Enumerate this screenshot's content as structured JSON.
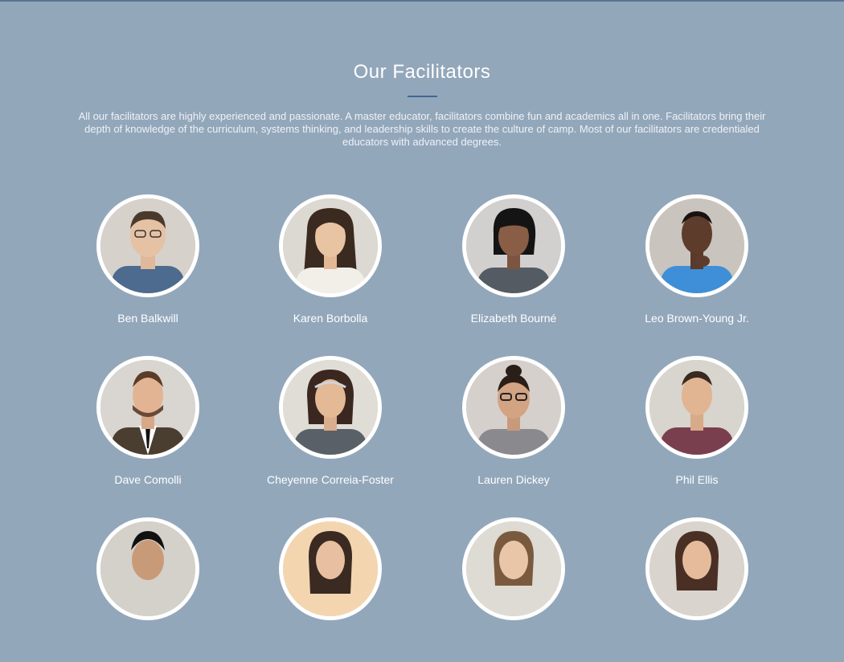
{
  "section": {
    "title": "Our Facilitators",
    "intro": "All our facilitators are highly experienced and passionate. A master educator, facilitators combine fun and academics all in one. Facilitators bring their depth of knowledge of the curriculum, systems thinking, and leadership skills to create the culture of camp. Most of our facilitators are credentialed educators with advanced degrees."
  },
  "colors": {
    "background": "#93a7bb",
    "accent": "#3f6891",
    "text": "#ffffff"
  },
  "facilitators": [
    {
      "name": "Ben Balkwill",
      "photo": "portrait-photo"
    },
    {
      "name": "Karen Borbolla",
      "photo": "portrait-photo"
    },
    {
      "name": "Elizabeth Bourné",
      "photo": "portrait-photo"
    },
    {
      "name": "Leo Brown-Young Jr.",
      "photo": "portrait-photo"
    },
    {
      "name": "Dave Comolli",
      "photo": "portrait-photo"
    },
    {
      "name": "Cheyenne Correia-Foster",
      "photo": "portrait-photo"
    },
    {
      "name": "Lauren Dickey",
      "photo": "portrait-photo"
    },
    {
      "name": "Phil Ellis",
      "photo": "portrait-photo"
    },
    {
      "name": "",
      "photo": "portrait-photo"
    },
    {
      "name": "",
      "photo": "portrait-photo"
    },
    {
      "name": "",
      "photo": "portrait-photo"
    },
    {
      "name": "",
      "photo": "portrait-photo"
    }
  ]
}
